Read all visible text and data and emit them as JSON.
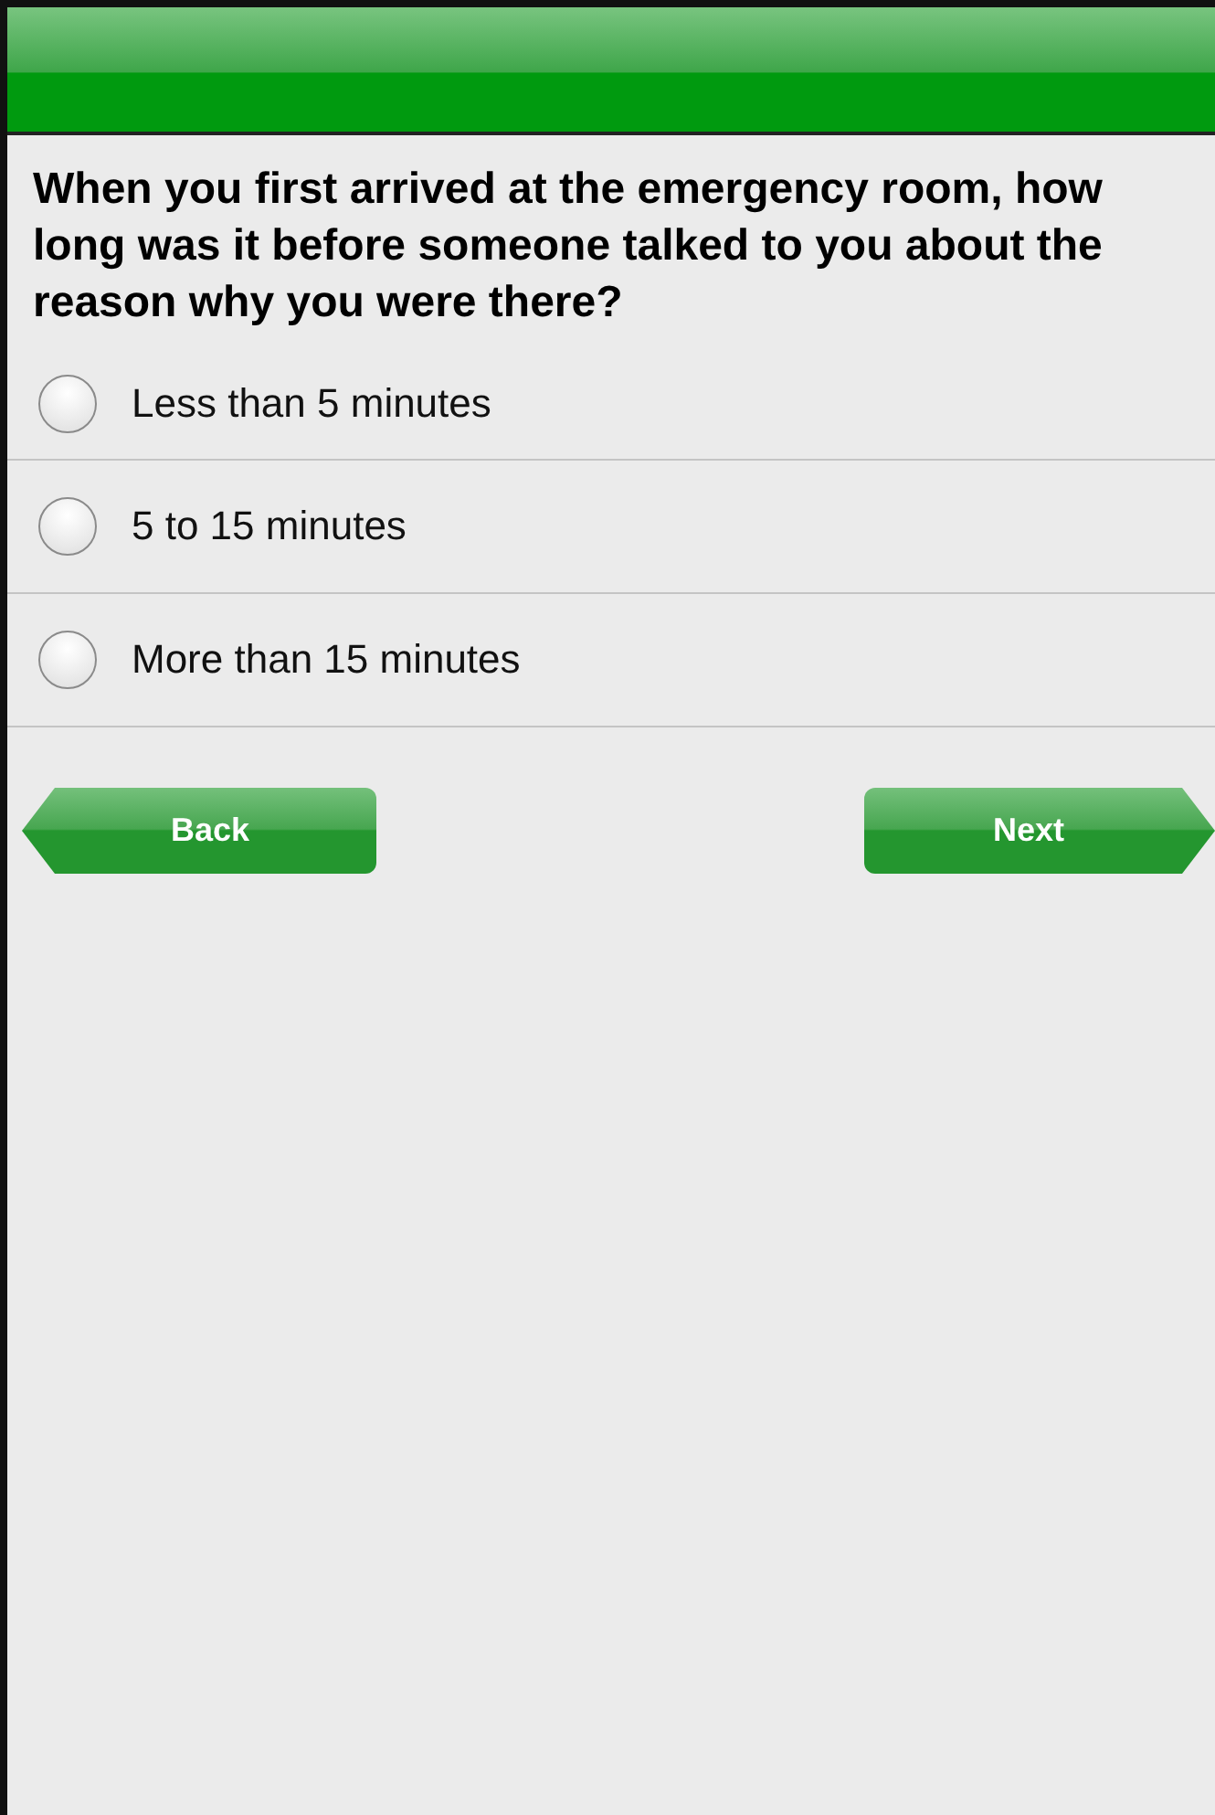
{
  "question": "When you first arrived at the emergency room, how long was it before someone talked to you about the reason why you were there?",
  "options": [
    {
      "label": "Less than 5 minutes",
      "selected": false
    },
    {
      "label": "5 to 15 minutes",
      "selected": false
    },
    {
      "label": "More than 15 minutes",
      "selected": false
    }
  ],
  "buttons": [
    {
      "label": "Back",
      "kind": "back"
    },
    {
      "label": "Next",
      "kind": "next"
    }
  ]
}
